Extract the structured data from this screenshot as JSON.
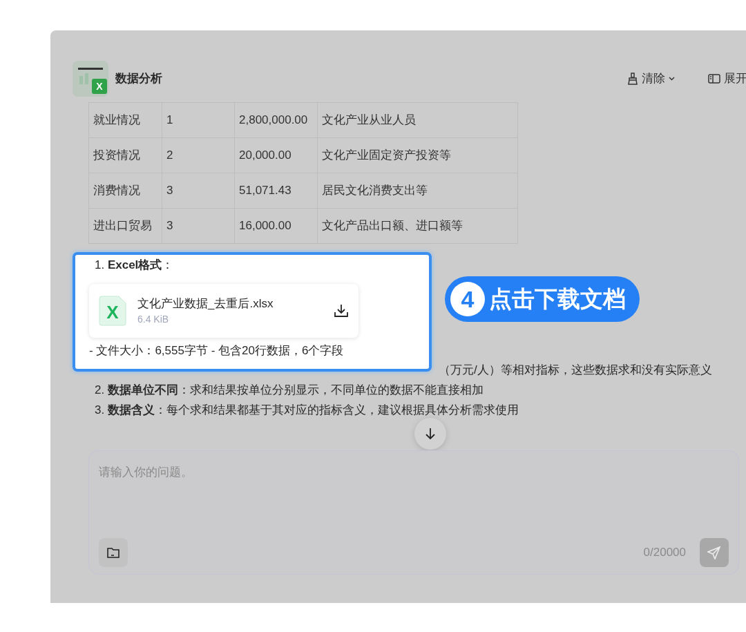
{
  "app": {
    "title": "数据分析",
    "logo_letter": "X"
  },
  "header_actions": [
    {
      "kind": "clear",
      "label": "清除"
    },
    {
      "kind": "expand",
      "label": "展开"
    }
  ],
  "table": {
    "rows": [
      [
        "就业情况",
        "1",
        "2,800,000.00",
        "文化产业从业人员"
      ],
      [
        "投资情况",
        "2",
        "20,000.00",
        "文化产业固定资产投资等"
      ],
      [
        "消费情况",
        "3",
        "51,071.43",
        "居民文化消费支出等"
      ],
      [
        "进出口贸易",
        "3",
        "16,000.00",
        "文化产品出口额、进口额等"
      ]
    ]
  },
  "highlight": {
    "heading": "1. **Excel格式**：",
    "file": {
      "icon_letter": "X",
      "name": "文化产业数据_去重后.xlsx",
      "size": "6.4 KiB"
    },
    "summary": "- 文件大小：6,555字节 - 包含20行数据，6个字段"
  },
  "callout": {
    "step": "4",
    "label": "点击下载文档"
  },
  "notes_tail": "（万元/人）等相对指标，这些数据求和没有实际意义",
  "notes": [
    "2. **数据单位不同**：求和结果按单位分别显示，不同单位的数据不能直接相加",
    "3. **数据含义**：每个求和结果都基于其对应的指标含义，建议根据具体分析需求使用"
  ],
  "composer": {
    "placeholder": "请输入你的问题。",
    "counter": "0/20000"
  }
}
